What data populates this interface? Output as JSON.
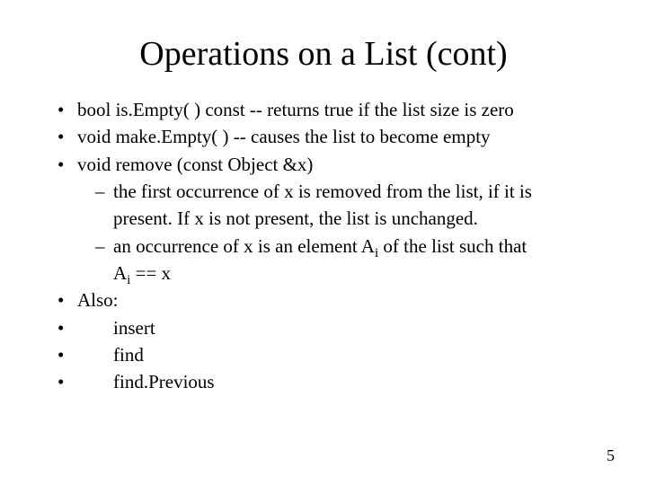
{
  "title": "Operations on a List (cont)",
  "bullets": {
    "b0": "bool is.Empty( ) const -- returns true if the list size is zero",
    "b1": "void make.Empty( ) -- causes the list to become empty",
    "b2": "void remove (const Object &x)",
    "b2s0a": "the first occurrence of x is removed from the list, if it is",
    "b2s0b": "present. If x is not present, the list is unchanged.",
    "b2s1a": "an occurrence of x is an element A",
    "b2s1b": " of the list such that",
    "b2s1c": "A",
    "b2s1d": " == x",
    "sub_i": "i",
    "b3": "Also:",
    "b4": "insert",
    "b5": "find",
    "b6": "find.Previous"
  },
  "glyphs": {
    "dot": "•",
    "dash": "–"
  },
  "page_number": "5"
}
